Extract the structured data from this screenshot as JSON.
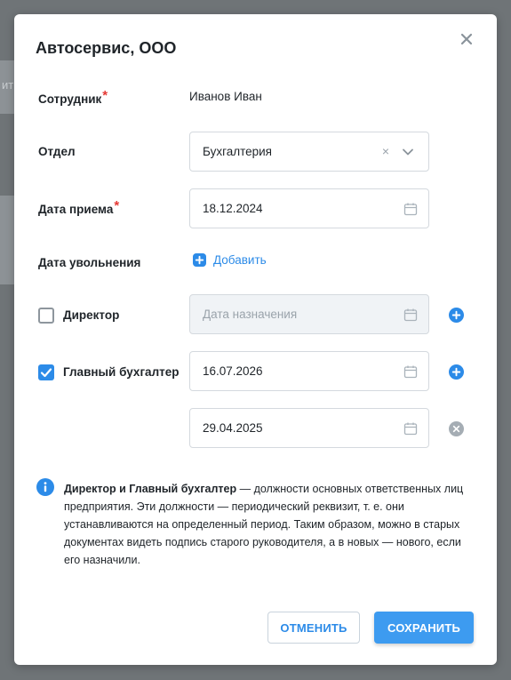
{
  "background": {
    "partial_text": "ит"
  },
  "modal": {
    "title": "Автосервис, ООО",
    "fields": {
      "employee": {
        "label": "Сотрудник",
        "required_mark": "*",
        "value": "Иванов Иван"
      },
      "department": {
        "label": "Отдел",
        "value": "Бухгалтерия",
        "clear_symbol": "×"
      },
      "hire_date": {
        "label": "Дата приема",
        "required_mark": "*",
        "value": "18.12.2024"
      },
      "dismissal_date": {
        "label": "Дата увольнения",
        "add_label": "Добавить"
      }
    },
    "roles": {
      "director": {
        "label": "Директор",
        "checked": false,
        "placeholder": "Дата назначения"
      },
      "chief_accountant": {
        "label": "Главный бухгалтер",
        "checked": true,
        "dates": [
          "16.07.2026",
          "29.04.2025"
        ]
      }
    },
    "info": {
      "bold": "Директор и Главный бухгалтер",
      "text": " — должности основных ответственных лиц предприятия. Эти должности — периодический реквизит, т. е. они устанавливаются на определенный период. Таким образом, можно в старых документах видеть подпись старого руководителя, а в новых — нового, если его назначили."
    },
    "buttons": {
      "cancel": "ОТМЕНИТЬ",
      "save": "СОХРАНИТЬ"
    }
  },
  "colors": {
    "accent": "#2c8be8",
    "save_button": "#3d9bf0",
    "required": "#e53935",
    "overlay": "#6f7477"
  }
}
